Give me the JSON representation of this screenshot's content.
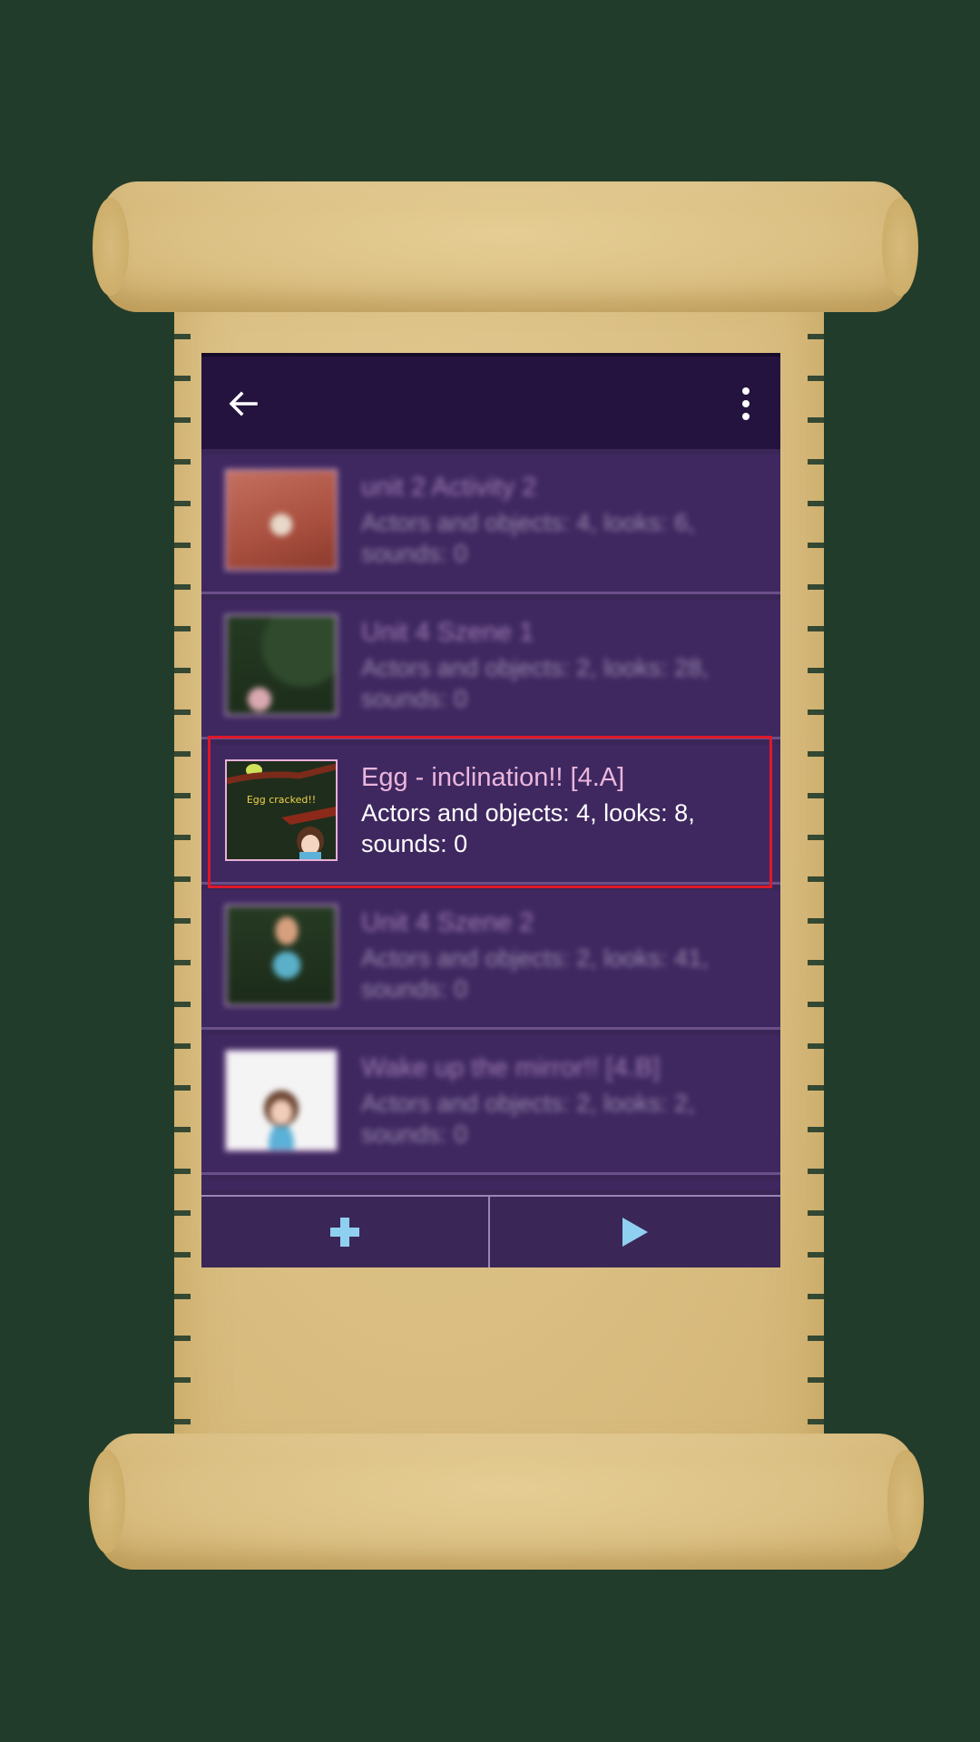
{
  "app_bar": {
    "back_icon": "arrow-left-icon",
    "menu_icon": "more-vertical-icon"
  },
  "projects": [
    {
      "title": "unit 2 Activity 2",
      "details": "Actors and objects: 4, looks: 6, sounds: 0",
      "blurred": true
    },
    {
      "title": "Unit 4 Szene 1",
      "details": "Actors and objects: 2, looks: 28, sounds: 0",
      "blurred": true
    },
    {
      "title": "Egg - inclination!! [4.A]",
      "details": "Actors and objects: 4, looks: 8, sounds: 0",
      "blurred": false,
      "thumb_caption": "Egg cracked!!"
    },
    {
      "title": "Unit 4 Szene 2",
      "details": "Actors and objects: 2, looks: 41, sounds: 0",
      "blurred": true
    },
    {
      "title": "Wake up the mirror!! [4.B]",
      "details": "Actors and objects: 2, looks: 2, sounds: 0",
      "blurred": true
    }
  ],
  "bottom_bar": {
    "add_icon": "plus-icon",
    "play_icon": "play-icon"
  },
  "colors": {
    "background": "#223c2b",
    "parchment": "#dcc186",
    "app_bar": "#24133f",
    "list_bg": "#3f2860",
    "title_pink": "#eab6dc",
    "selection_red": "#e0182a",
    "accent_blue": "#8fd0f0"
  }
}
